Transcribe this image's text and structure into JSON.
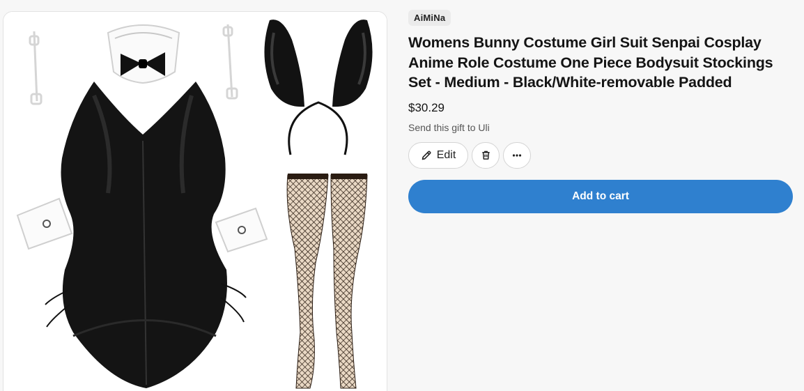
{
  "product": {
    "brand": "AiMiNa",
    "title": "Womens Bunny Costume Girl Suit Senpai Cosplay Anime Role Costume One Piece Bodysuit Stockings Set - Medium - Black/White-removable Padded",
    "price": "$30.29",
    "gift_note": "Send this gift to Uli",
    "image_alt": "Black bunny costume set with collar, bow tie, cuffs, ears headband and fishnet stockings"
  },
  "actions": {
    "edit_label": "Edit",
    "delete_icon": "trash-icon",
    "more_icon": "more-horizontal-icon",
    "add_to_cart_label": "Add to cart"
  },
  "colors": {
    "accent": "#2f80cf",
    "background": "#f7f7f7",
    "badge_bg": "#ebebeb"
  }
}
